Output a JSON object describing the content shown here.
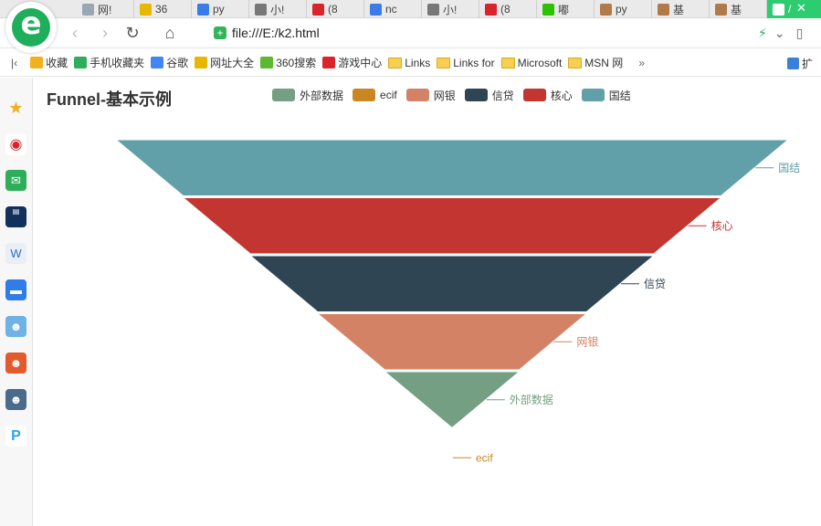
{
  "browser": {
    "logo_glyph": "e",
    "tabs": [
      {
        "label": "网!",
        "icon": "page-icon",
        "color": "#9aa7b3"
      },
      {
        "label": "36",
        "icon": "360-icon",
        "color": "#e6b800"
      },
      {
        "label": "py",
        "icon": "baidu-paw-icon",
        "color": "#3b7be8"
      },
      {
        "label": "小!",
        "icon": "zhihu-icon",
        "color": "#777777"
      },
      {
        "label": "(8",
        "icon": "csdn-icon",
        "color": "#d9252a"
      },
      {
        "label": "nc",
        "icon": "baidu-paw-icon",
        "color": "#3b7be8"
      },
      {
        "label": "小!",
        "icon": "zhihu-icon",
        "color": "#777777"
      },
      {
        "label": "(8",
        "icon": "csdn-icon",
        "color": "#d9252a"
      },
      {
        "label": "嘟",
        "icon": "wechat-icon",
        "color": "#2dc100"
      },
      {
        "label": "py",
        "icon": "avatar-icon",
        "color": "#b07a4a"
      },
      {
        "label": "基",
        "icon": "avatar-icon",
        "color": "#b07a4a"
      },
      {
        "label": "基",
        "icon": "avatar-icon",
        "color": "#b07a4a"
      },
      {
        "label": "/",
        "icon": "page-icon",
        "color": "#ffffff"
      }
    ],
    "close_tab": "✕",
    "back": "‹",
    "forward": "›",
    "reload": "↻",
    "home": "⌂",
    "url": "file:///E:/k2.html",
    "bookmarks": [
      {
        "label": "收藏",
        "icon": "star-icon",
        "color": "#f2b01e",
        "kind": "icon"
      },
      {
        "label": "手机收藏夹",
        "icon": "phone-icon",
        "color": "#2eae5a",
        "kind": "icon"
      },
      {
        "label": "谷歌",
        "icon": "google-icon",
        "color": "#4285f4",
        "kind": "icon"
      },
      {
        "label": "网址大全",
        "icon": "360-icon",
        "color": "#e6b800",
        "kind": "icon"
      },
      {
        "label": "360搜索",
        "icon": "360-search-icon",
        "color": "#5bb830",
        "kind": "icon"
      },
      {
        "label": "游戏中心",
        "icon": "game-icon",
        "color": "#d9252a",
        "kind": "icon"
      },
      {
        "label": "Links",
        "icon": "folder-icon",
        "color": "#f7cf52",
        "kind": "folder"
      },
      {
        "label": "Links for",
        "icon": "folder-icon",
        "color": "#f7cf52",
        "kind": "folder"
      },
      {
        "label": "Microsoft",
        "icon": "folder-icon",
        "color": "#f7cf52",
        "kind": "folder"
      },
      {
        "label": "MSN 网",
        "icon": "folder-icon",
        "color": "#f7cf52",
        "kind": "folder"
      }
    ],
    "bookmarks_more": "»",
    "extensions_label": "扩"
  },
  "chart_data": {
    "type": "funnel",
    "title": "Funnel-基本示例",
    "legend": [
      "外部数据",
      "ecif",
      "网银",
      "信贷",
      "核心",
      "国结"
    ],
    "legend_placement": "top",
    "sort": "ascending",
    "min": 0,
    "max": 100,
    "series": [
      {
        "name": "国结",
        "value": 100,
        "color": "#61a0a8"
      },
      {
        "name": "核心",
        "value": 80,
        "color": "#c23531"
      },
      {
        "name": "信贷",
        "value": 60,
        "color": "#2f4554"
      },
      {
        "name": "网银",
        "value": 40,
        "color": "#d48265"
      },
      {
        "name": "外部数据",
        "value": 20,
        "color": "#749f83"
      },
      {
        "name": "ecif",
        "value": 0,
        "color": "#ca8622"
      }
    ]
  }
}
